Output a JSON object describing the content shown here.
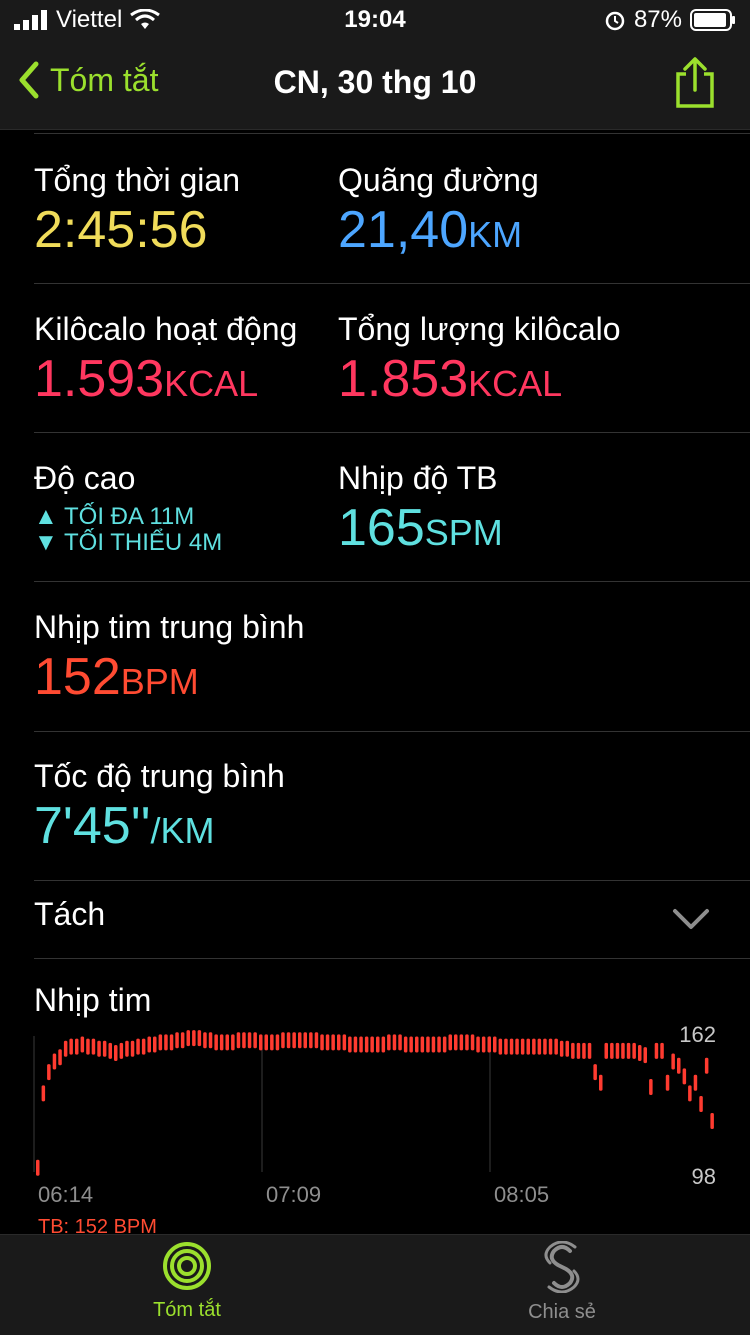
{
  "status_bar": {
    "carrier": "Viettel",
    "time": "19:04",
    "battery": "87%"
  },
  "nav": {
    "back_label": "Tóm tắt",
    "title": "CN, 30 thg 10"
  },
  "metrics": {
    "total_time": {
      "label": "Tổng thời gian",
      "value": "2:45:56"
    },
    "distance": {
      "label": "Quãng đường",
      "value": "21,40",
      "unit": "KM"
    },
    "active_kcal": {
      "label": "Kilôcalo hoạt động",
      "value": "1.593",
      "unit": "KCAL"
    },
    "total_kcal": {
      "label": "Tổng lượng kilôcalo",
      "value": "1.853",
      "unit": "KCAL"
    },
    "elevation": {
      "label": "Độ cao",
      "max": "▲ TỐI ĐA 11M",
      "min": "▼ TỐI THIỂU 4M"
    },
    "cadence": {
      "label": "Nhịp độ TB",
      "value": "165",
      "unit": "SPM"
    },
    "avg_hr": {
      "label": "Nhịp tim trung bình",
      "value": "152",
      "unit": "BPM"
    },
    "avg_pace": {
      "label": "Tốc độ trung bình",
      "value": "7'45''",
      "unit": "/KM"
    }
  },
  "splits": {
    "label": "Tách"
  },
  "heart_rate": {
    "title": "Nhịp tim",
    "avg_label": "TB: 152 BPM",
    "y_max_label": "162",
    "y_min_label": "98",
    "x_labels": [
      "06:14",
      "07:09",
      "08:05"
    ]
  },
  "chart_data": {
    "type": "bar",
    "title": "Nhịp tim",
    "x": [
      "06:14",
      "07:09",
      "08:05"
    ],
    "ylim": [
      98,
      162
    ],
    "values": [
      100,
      135,
      145,
      150,
      152,
      156,
      157,
      157,
      158,
      157,
      157,
      156,
      156,
      155,
      154,
      155,
      156,
      156,
      157,
      157,
      158,
      158,
      159,
      159,
      159,
      160,
      160,
      161,
      161,
      161,
      160,
      160,
      159,
      159,
      159,
      159,
      160,
      160,
      160,
      160,
      159,
      159,
      159,
      159,
      160,
      160,
      160,
      160,
      160,
      160,
      160,
      159,
      159,
      159,
      159,
      159,
      158,
      158,
      158,
      158,
      158,
      158,
      158,
      159,
      159,
      159,
      158,
      158,
      158,
      158,
      158,
      158,
      158,
      158,
      159,
      159,
      159,
      159,
      159,
      158,
      158,
      158,
      158,
      157,
      157,
      157,
      157,
      157,
      157,
      157,
      157,
      157,
      157,
      157,
      156,
      156,
      155,
      155,
      155,
      155,
      145,
      140,
      155,
      155,
      155,
      155,
      155,
      155,
      154,
      153,
      138,
      155,
      155,
      140,
      150,
      148,
      143,
      135,
      140,
      130,
      148,
      122
    ],
    "colors": {
      "bar": "#ff3b30"
    },
    "grid": true
  },
  "tabs": [
    {
      "label": "Tóm tắt",
      "icon": "activity-rings-icon",
      "active": true
    },
    {
      "label": "Chia sẻ",
      "icon": "sharing-icon",
      "active": false
    }
  ],
  "colors": {
    "accent": "#9be02d",
    "time": "#f0dc5a",
    "distance": "#4da6ff",
    "kcal": "#ff375f",
    "cadence": "#5fe0e0",
    "heart": "#ff4b32"
  }
}
